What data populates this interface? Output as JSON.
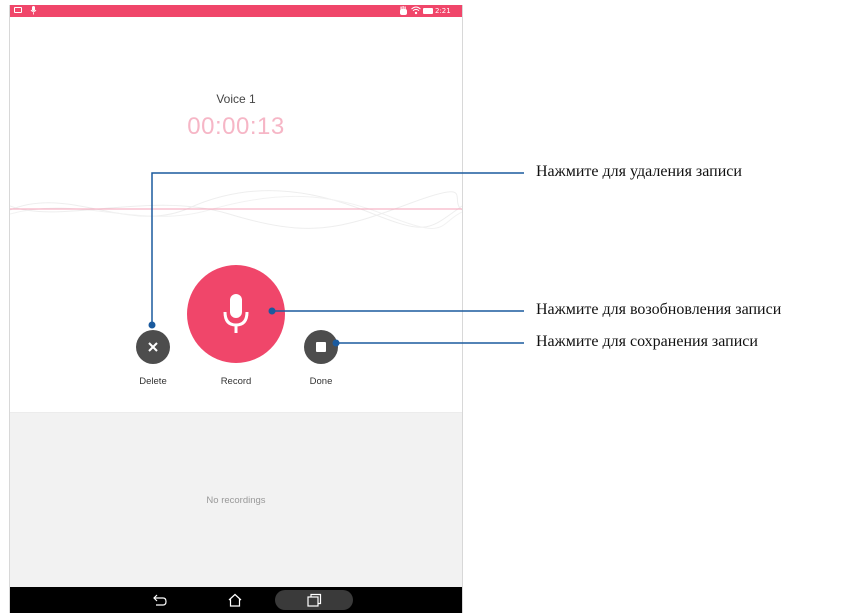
{
  "status_bar": {
    "time": "2:21 AM",
    "background_color": "#f0466a",
    "icons": [
      "image-icon",
      "mic-icon",
      "hand-icon",
      "wifi-icon",
      "battery-icon"
    ]
  },
  "recording": {
    "title": "Voice 1",
    "timer": "00:00:13"
  },
  "controls": {
    "delete_label": "Delete",
    "record_label": "Record",
    "done_label": "Done",
    "accent_color": "#f0466a",
    "secondary_color": "#4d4d4d"
  },
  "recordings": {
    "empty_text": "No recordings"
  },
  "nav_bar": {
    "icons": [
      "back-icon",
      "home-icon",
      "recents-icon"
    ]
  },
  "callouts": {
    "delete": "Нажмите для удаления записи",
    "resume": "Нажмите для возобновления записи",
    "save": "Нажмите для сохранения записи"
  }
}
